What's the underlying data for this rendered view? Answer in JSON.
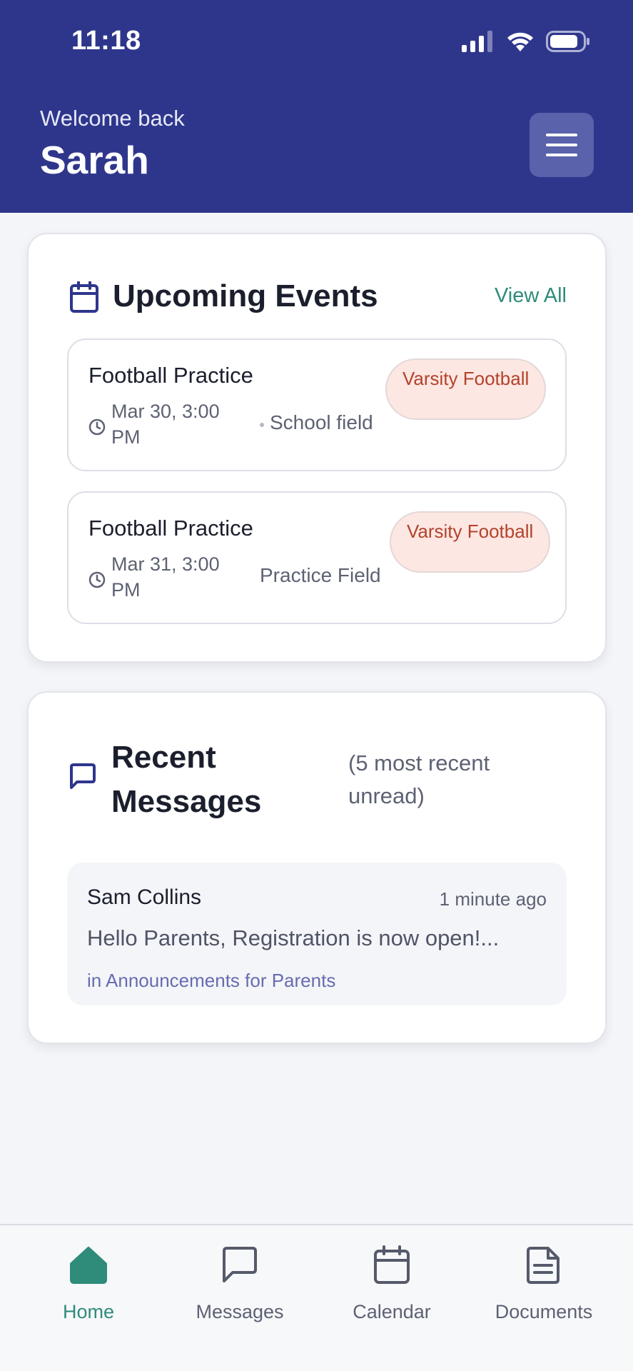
{
  "status_bar": {
    "time": "11:18"
  },
  "header": {
    "welcome": "Welcome back",
    "user_name": "Sarah"
  },
  "events": {
    "title": "Upcoming Events",
    "view_all": "View All",
    "items": [
      {
        "title": "Football Practice",
        "date": "Mar 30, 3:00 PM",
        "location": "School field",
        "badge": "Varsity Football"
      },
      {
        "title": "Football Practice",
        "date": "Mar 31, 3:00 PM",
        "location": "Practice Field",
        "badge": "Varsity Football"
      }
    ]
  },
  "messages": {
    "title": "Recent Messages",
    "subtitle": "(5 most recent unread)",
    "items": [
      {
        "sender": "Sam Collins",
        "time": "1 minute ago",
        "preview": "Hello Parents, Registration is now open!...",
        "channel": "in Announcements for Parents"
      }
    ]
  },
  "tabs": [
    {
      "label": "Home",
      "icon": "home-icon",
      "active": true
    },
    {
      "label": "Messages",
      "icon": "message-icon",
      "active": false
    },
    {
      "label": "Calendar",
      "icon": "calendar-icon",
      "active": false
    },
    {
      "label": "Documents",
      "icon": "document-icon",
      "active": false
    }
  ],
  "colors": {
    "header_bg": "#2e368c",
    "accent_green": "#2f8b7a",
    "badge_bg": "#fde7e2",
    "badge_text": "#b2432c",
    "channel_text": "#666cb0"
  }
}
